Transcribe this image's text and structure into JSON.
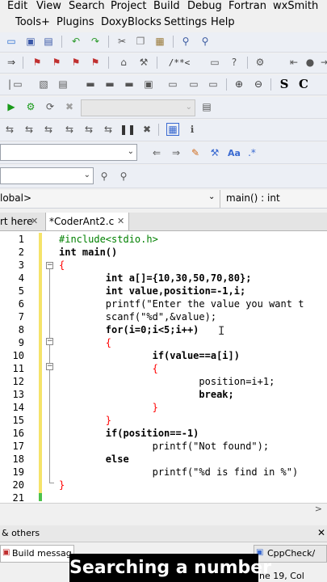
{
  "menu": [
    "Edit",
    "View",
    "Search",
    "Project",
    "Build",
    "Debug",
    "Fortran",
    "wxSmith",
    "Tools+",
    "Plugins",
    "DoxyBlocks",
    "Settings",
    "Help"
  ],
  "scope": {
    "left": "lobal>",
    "right": "main() : int"
  },
  "tabs": [
    {
      "label": "rt here"
    },
    {
      "label": "*CoderAnt2.c"
    }
  ],
  "code": {
    "lines": [
      {
        "n": "1",
        "text": "#include<stdio.h>"
      },
      {
        "n": "2",
        "text": "int main()"
      },
      {
        "n": "3",
        "text": "{"
      },
      {
        "n": "4",
        "text": "        int a[]={10,30,50,70,80};"
      },
      {
        "n": "5",
        "text": "        int value,position=-1,i;"
      },
      {
        "n": "6",
        "text": "        printf(\"Enter the value you want t"
      },
      {
        "n": "7",
        "text": "        scanf(\"%d\",&value);"
      },
      {
        "n": "8",
        "text": "        for(i=0;i<5;i++)"
      },
      {
        "n": "9",
        "text": "        {"
      },
      {
        "n": "10",
        "text": "                if(value==a[i])"
      },
      {
        "n": "11",
        "text": "                {"
      },
      {
        "n": "12",
        "text": "                        position=i+1;"
      },
      {
        "n": "13",
        "text": "                        break;"
      },
      {
        "n": "14",
        "text": "                }"
      },
      {
        "n": "15",
        "text": "        }"
      },
      {
        "n": "16",
        "text": "        if(position==-1)"
      },
      {
        "n": "17",
        "text": "                printf(\"Not found\");"
      },
      {
        "n": "18",
        "text": "        else"
      },
      {
        "n": "19",
        "text": "                printf(\"%d is find in %\")"
      },
      {
        "n": "20",
        "text": "}"
      },
      {
        "n": "21",
        "text": ""
      }
    ]
  },
  "logs": {
    "header": "& others",
    "build_tab": "Build messag",
    "cppcheck_tab": "CppCheck/"
  },
  "status": {
    "position": "ine 19, Col"
  },
  "caption": "Searching a number",
  "colors": {
    "accent": "#1e6fd9",
    "toolbar_bg": "#eceff5",
    "preprocessor": "#008000",
    "string": "#0000c8",
    "number": "#ff0000"
  }
}
